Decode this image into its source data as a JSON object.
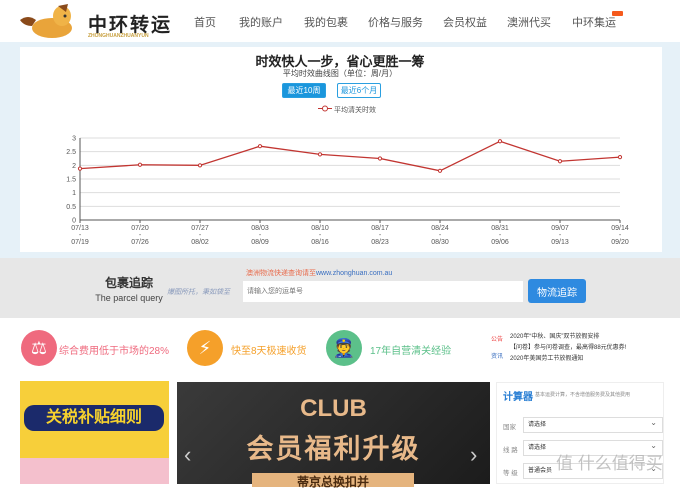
{
  "header": {
    "logo_text": "中环转运",
    "logo_sub": "ZHONGHUANZHUANYUN",
    "nav": [
      "首页",
      "我的账户",
      "我的包裹",
      "价格与服务",
      "会员权益",
      "澳洲代买",
      "中环集运"
    ]
  },
  "chart_section": {
    "title": "时效快人一步，省心更胜一筹",
    "subtitle": "平均时效曲线图（单位：周/月）",
    "btn_10": "最近10周",
    "btn_6": "最近6个月"
  },
  "chart_data": {
    "type": "line",
    "legend": "平均清关时效",
    "ylim": [
      0,
      3
    ],
    "yticks": [
      "0",
      "0.5",
      "1",
      "1.5",
      "2",
      "2.5",
      "3"
    ],
    "categories": [
      [
        "07/13",
        "07/19"
      ],
      [
        "07/20",
        "07/26"
      ],
      [
        "07/27",
        "08/02"
      ],
      [
        "08/03",
        "08/09"
      ],
      [
        "08/10",
        "08/16"
      ],
      [
        "08/17",
        "08/23"
      ],
      [
        "08/24",
        "08/30"
      ],
      [
        "08/31",
        "09/06"
      ],
      [
        "09/07",
        "09/13"
      ],
      [
        "09/14",
        "09/20"
      ]
    ],
    "values": [
      1.88,
      2.02,
      2.0,
      2.7,
      2.4,
      2.25,
      1.8,
      2.88,
      2.15,
      2.3
    ],
    "color": "#c23531"
  },
  "tracking": {
    "title": "包裹追踪",
    "subtitle": "The parcel query",
    "hint": "爆图所托，秉如袋至",
    "link_prefix": "澳洲物流快递查询请至",
    "link_url": "www.zhonghuan.com.au",
    "placeholder": "请输入您的运单号",
    "button": "物流追踪"
  },
  "features": [
    {
      "text": "综合费用低于市场的28%",
      "color": "#ef6a7e"
    },
    {
      "text": "快至8天极速收货",
      "color": "#f5a02a"
    },
    {
      "text": "17年自营清关经验",
      "color": "#5cc08a"
    }
  ],
  "news": {
    "tag1": "公告",
    "tag2": "资讯",
    "items": [
      "2020年“中秋、国庆”双节放假安排",
      "【问卷】参与问卷调查，最高得88元优惠券!",
      "2020年美国劳工节放假通知"
    ]
  },
  "ads": {
    "left_text": "关税补贴细则",
    "banner_title": "CLUB",
    "banner_sub": "会员福利升级",
    "banner_tag": "蒂京总换扣并"
  },
  "calculator": {
    "title": "计算器",
    "subtitle": "基本运费计算，不含增值服务费及其他费用",
    "fields": [
      {
        "label": "国家",
        "value": "请选择"
      },
      {
        "label": "线 路",
        "value": "请选择"
      },
      {
        "label": "等 级",
        "value": "普通会员"
      }
    ]
  },
  "watermark": "值 什么值得买"
}
